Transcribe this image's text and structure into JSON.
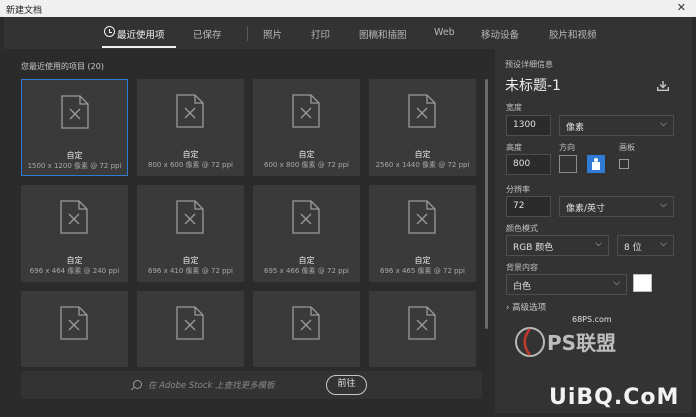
{
  "window": {
    "title": "新建文档",
    "close_glyph": "✕"
  },
  "tabs": [
    {
      "label": "最近使用项",
      "active": true
    },
    {
      "label": "已保存"
    },
    {
      "label": "照片"
    },
    {
      "label": "打印"
    },
    {
      "label": "图稿和插图"
    },
    {
      "label": "Web"
    },
    {
      "label": "移动设备"
    },
    {
      "label": "胶片和视频"
    }
  ],
  "recent": {
    "heading": "您最近使用的项目",
    "count": "(20)",
    "cards": [
      {
        "name": "自定",
        "spec": "1500 x 1200 像素 @ 72 ppi",
        "selected": true
      },
      {
        "name": "自定",
        "spec": "800 x 600 像素 @ 72 ppi"
      },
      {
        "name": "自定",
        "spec": "600 x 800 像素 @ 72 ppi"
      },
      {
        "name": "自定",
        "spec": "2560 x 1440 像素 @ 72 ppi"
      },
      {
        "name": "自定",
        "spec": "696 x 464 像素 @ 240 ppi"
      },
      {
        "name": "自定",
        "spec": "696 x 410 像素 @ 72 ppi"
      },
      {
        "name": "自定",
        "spec": "695 x 466 像素 @ 72 ppi"
      },
      {
        "name": "自定",
        "spec": "696 x 465 像素 @ 72 ppi"
      },
      {
        "name": "",
        "spec": ""
      },
      {
        "name": "",
        "spec": ""
      },
      {
        "name": "",
        "spec": ""
      },
      {
        "name": "",
        "spec": ""
      }
    ]
  },
  "stock": {
    "placeholder": "在 Adobe Stock 上查找更多模板",
    "go_label": "前往"
  },
  "preset": {
    "heading": "预设详细信息",
    "doc_name": "未标题-1",
    "width_label": "宽度",
    "width_value": "1300",
    "width_unit": "像素",
    "height_label": "高度",
    "height_value": "800",
    "orientation_label": "方向",
    "artboard_label": "画板",
    "resolution_label": "分辨率",
    "resolution_value": "72",
    "resolution_unit": "像素/英寸",
    "color_mode_label": "颜色模式",
    "color_mode_value": "RGB 颜色",
    "bit_depth_value": "8 位",
    "background_label": "背景内容",
    "background_value": "白色",
    "advanced_label": "高级选项"
  },
  "colors": {
    "accent": "#2f7bd6",
    "panel": "#333333",
    "canvas": "#2b2b2b",
    "card": "#3a3a3a",
    "background_swatch": "#ffffff"
  },
  "watermarks": {
    "site": "68PS.com",
    "brand": "PS联盟",
    "domain": "UiBQ.CoM"
  }
}
